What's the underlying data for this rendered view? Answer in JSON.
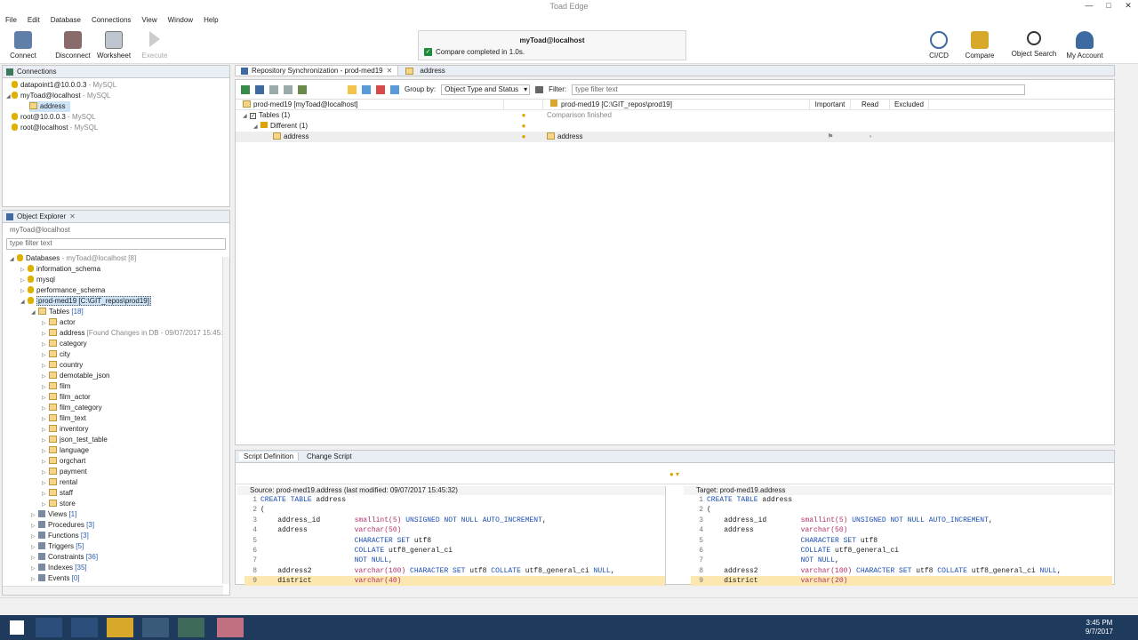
{
  "window": {
    "title": "Toad Edge"
  },
  "menu": [
    "File",
    "Edit",
    "Database",
    "Connections",
    "View",
    "Window",
    "Help"
  ],
  "toolbar": {
    "left": [
      {
        "label": "Connect",
        "icon": "connect-icon"
      },
      {
        "label": "Disconnect",
        "icon": "disconnect-icon"
      },
      {
        "label": "Worksheet",
        "icon": "worksheet-icon"
      },
      {
        "label": "Execute",
        "icon": "execute-icon"
      }
    ],
    "right": [
      {
        "label": "CI/CD",
        "icon": "cicd-icon"
      },
      {
        "label": "Compare",
        "icon": "compare-icon"
      },
      {
        "label": "Object Search",
        "icon": "object-search-icon"
      },
      {
        "label": "My Account",
        "icon": "account-icon"
      }
    ]
  },
  "notification": {
    "title": "myToad@localhost",
    "message": "Compare completed in 1.0s."
  },
  "connections": {
    "tab": "Connections",
    "items": [
      {
        "name": "datapoint1@10.0.0.3",
        "type": " - MySQL"
      },
      {
        "name": "myToad@localhost",
        "type": " - MySQL"
      },
      {
        "name": "address",
        "type": ""
      },
      {
        "name": "root@10.0.0.3",
        "type": " - MySQL"
      },
      {
        "name": "root@localhost",
        "type": " - MySQL"
      }
    ]
  },
  "explorer": {
    "tab": "Object Explorer",
    "connection": "myToad@localhost",
    "filter_placeholder": "type filter text",
    "databases_label": "Databases",
    "databases_suffix": " - myToad@localhost [8]",
    "dbs": [
      "information_schema",
      "mysql",
      "performance_schema"
    ],
    "project": "prod-med19 [C:\\GIT_repos\\prod19]",
    "tables_label": "Tables",
    "tables_count": "[18]",
    "tables": [
      {
        "name": "actor",
        "note": ""
      },
      {
        "name": "address",
        "note": "[Found Changes in DB - 09/07/2017 15:45:"
      },
      {
        "name": "category",
        "note": ""
      },
      {
        "name": "city",
        "note": ""
      },
      {
        "name": "country",
        "note": ""
      },
      {
        "name": "demotable_json",
        "note": ""
      },
      {
        "name": "film",
        "note": ""
      },
      {
        "name": "film_actor",
        "note": ""
      },
      {
        "name": "film_category",
        "note": ""
      },
      {
        "name": "film_text",
        "note": ""
      },
      {
        "name": "inventory",
        "note": ""
      },
      {
        "name": "json_test_table",
        "note": ""
      },
      {
        "name": "language",
        "note": ""
      },
      {
        "name": "orgchart",
        "note": ""
      },
      {
        "name": "payment",
        "note": ""
      },
      {
        "name": "rental",
        "note": ""
      },
      {
        "name": "staff",
        "note": ""
      },
      {
        "name": "store",
        "note": ""
      }
    ],
    "other": [
      {
        "name": "Views",
        "count": "[1]"
      },
      {
        "name": "Procedures",
        "count": "[3]"
      },
      {
        "name": "Functions",
        "count": "[3]"
      },
      {
        "name": "Triggers",
        "count": "[5]"
      },
      {
        "name": "Constraints",
        "count": "[36]"
      },
      {
        "name": "Indexes",
        "count": "[35]"
      },
      {
        "name": "Events",
        "count": "[0]"
      }
    ]
  },
  "editor_tabs": [
    "Repository Synchronization - prod-med19",
    "address"
  ],
  "sync": {
    "group_by_label": "Group by:",
    "group_by_value": "Object Type and Status",
    "filter_label": "Filter:",
    "filter_placeholder": "type filter text",
    "left_header": "prod-med19 [myToad@localhost]",
    "right_header": "prod-med19 [C:\\GIT_repos\\prod19]",
    "col_important": "Important",
    "col_read": "Read",
    "col_excluded": "Excluded",
    "tables": "Tables (1)",
    "status": "Comparison finished",
    "different": "Different (1)",
    "left_item": "address",
    "right_item": "address"
  },
  "script": {
    "tabs": [
      "Script Definition",
      "Change Script"
    ],
    "source_header": "Source: prod-med19.address (last modified: 09/07/2017 15:45:32)",
    "target_header": "Target: prod-med19.address",
    "source_lines": [
      {
        "n": "1",
        "t": "CREATE TABLE address"
      },
      {
        "n": "2",
        "t": "("
      },
      {
        "n": "3",
        "t": "    address_id        smallint(5) UNSIGNED NOT NULL AUTO_INCREMENT,"
      },
      {
        "n": "4",
        "t": "    address           varchar(50)"
      },
      {
        "n": "5",
        "t": "                      CHARACTER SET utf8"
      },
      {
        "n": "6",
        "t": "                      COLLATE utf8_general_ci"
      },
      {
        "n": "7",
        "t": "                      NOT NULL,"
      },
      {
        "n": "8",
        "t": "    address2          varchar(100) CHARACTER SET utf8 COLLATE utf8_general_ci NULL,"
      },
      {
        "n": "9",
        "t": "    district          varchar(40)"
      }
    ],
    "target_lines": [
      {
        "n": "1",
        "t": "CREATE TABLE address"
      },
      {
        "n": "2",
        "t": "("
      },
      {
        "n": "3",
        "t": "    address_id        smallint(5) UNSIGNED NOT NULL AUTO_INCREMENT,"
      },
      {
        "n": "4",
        "t": "    address           varchar(50)"
      },
      {
        "n": "5",
        "t": "                      CHARACTER SET utf8"
      },
      {
        "n": "6",
        "t": "                      COLLATE utf8_general_ci"
      },
      {
        "n": "7",
        "t": "                      NOT NULL,"
      },
      {
        "n": "8",
        "t": "    address2          varchar(100) CHARACTER SET utf8 COLLATE utf8_general_ci NULL,"
      },
      {
        "n": "9",
        "t": "    district          varchar(20)"
      }
    ]
  },
  "clock": {
    "time": "3:45 PM",
    "date": "9/7/2017"
  },
  "colors": {
    "accent": "#1a4db3",
    "highlight": "#fde7b0",
    "selection": "#cde3f7"
  }
}
